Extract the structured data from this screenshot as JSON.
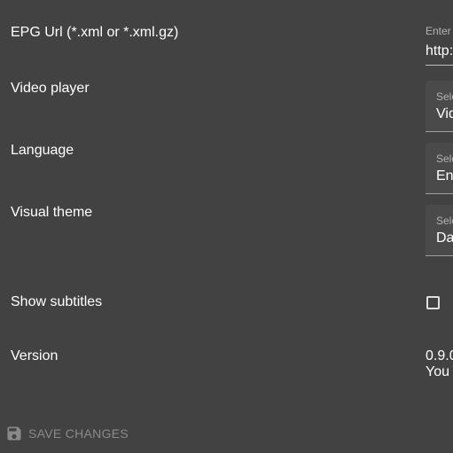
{
  "settings": {
    "epg": {
      "label": "EPG Url (*.xml or *.xml.gz)",
      "hint": "Enter",
      "value": "http:"
    },
    "video_player": {
      "label": "Video player",
      "hint": "Sele",
      "value": "Vid"
    },
    "language": {
      "label": "Language",
      "hint": "Sele",
      "value": "En"
    },
    "visual_theme": {
      "label": "Visual theme",
      "hint": "Sele",
      "value": "Da"
    },
    "show_subtitles": {
      "label": "Show subtitles",
      "checked": false
    },
    "version": {
      "label": "Version",
      "value": "0.9.0",
      "note": "You"
    }
  },
  "actions": {
    "save_label": "SAVE CHANGES",
    "save_icon": "save-icon"
  },
  "colors": {
    "background": "#424242",
    "field_fill": "#4a4a4a",
    "disabled_text": "#8a8a8a"
  }
}
